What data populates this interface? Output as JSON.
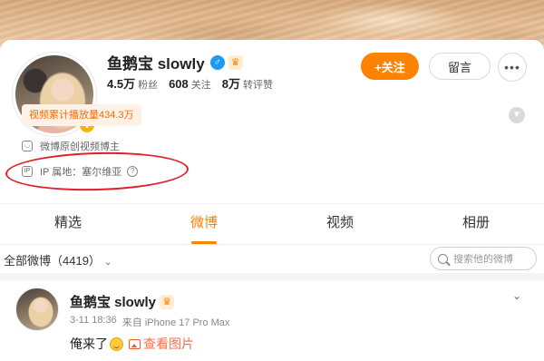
{
  "profile": {
    "name": "鱼鹅宝 slowly",
    "gender_icon": "male-icon",
    "vip_icon": "crown-icon",
    "stats": [
      {
        "num": "4.5万",
        "label": "粉丝"
      },
      {
        "num": "608",
        "label": "关注"
      },
      {
        "num": "8万",
        "label": "转评赞"
      }
    ],
    "follow_label": "+关注",
    "message_label": "留言",
    "more_label": "•••",
    "play_count": "视频累计播放量434.3万",
    "creator_text": "微博原创视频博主",
    "ip_text": "IP 属地：塞尔维亚",
    "help_symbol": "?"
  },
  "tabs": [
    {
      "label": "精选",
      "active": false
    },
    {
      "label": "微博",
      "active": true
    },
    {
      "label": "视频",
      "active": false
    },
    {
      "label": "相册",
      "active": false
    }
  ],
  "filter": {
    "label": "全部微博（4419）",
    "chevron": "⌄",
    "search_placeholder": "搜索他的微博"
  },
  "post": {
    "author": "鱼鹅宝 slowly",
    "time": "3-11 18:36",
    "source": "来自 iPhone 17 Pro Max",
    "text": "俺来了",
    "view_pictures": "查看图片",
    "chevron": "⌄"
  },
  "colors": {
    "accent": "#ff8200",
    "annotation_circle": "#e0202a"
  }
}
